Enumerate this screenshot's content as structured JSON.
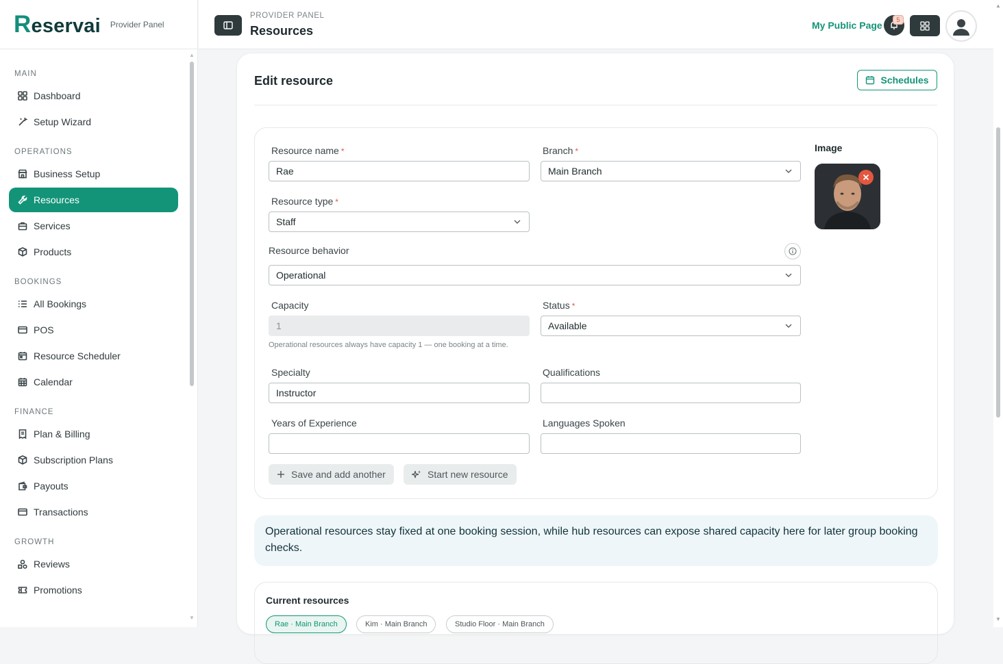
{
  "brand": {
    "logo_initial": "R",
    "logo_rest": "eservai",
    "subtitle": "Provider Panel"
  },
  "sidebar": {
    "sections": [
      {
        "title": "MAIN",
        "items": [
          {
            "label": "Dashboard",
            "icon": "grid-icon"
          },
          {
            "label": "Setup Wizard",
            "icon": "wand-icon"
          }
        ]
      },
      {
        "title": "OPERATIONS",
        "items": [
          {
            "label": "Business Setup",
            "icon": "store-icon"
          },
          {
            "label": "Resources",
            "icon": "wrench-icon",
            "active": true
          },
          {
            "label": "Services",
            "icon": "briefcase-icon"
          },
          {
            "label": "Products",
            "icon": "box-icon"
          }
        ]
      },
      {
        "title": "BOOKINGS",
        "items": [
          {
            "label": "All Bookings",
            "icon": "list-icon"
          },
          {
            "label": "POS",
            "icon": "card-icon"
          },
          {
            "label": "Resource Scheduler",
            "icon": "calendar-icon"
          },
          {
            "label": "Calendar",
            "icon": "calendar-grid-icon"
          }
        ]
      },
      {
        "title": "FINANCE",
        "items": [
          {
            "label": "Plan & Billing",
            "icon": "receipt-icon"
          },
          {
            "label": "Subscription Plans",
            "icon": "box-icon"
          },
          {
            "label": "Payouts",
            "icon": "wallet-icon"
          },
          {
            "label": "Transactions",
            "icon": "card-icon"
          }
        ]
      },
      {
        "title": "GROWTH",
        "items": [
          {
            "label": "Reviews",
            "icon": "shapes-icon"
          },
          {
            "label": "Promotions",
            "icon": "ticket-icon"
          }
        ]
      }
    ]
  },
  "header": {
    "breadcrumb": "PROVIDER PANEL",
    "title": "Resources",
    "public_link": "My Public Page",
    "notification_count": "5"
  },
  "main": {
    "card_title": "Edit resource",
    "schedules_label": "Schedules",
    "form": {
      "resource_name_label": "Resource name",
      "resource_name_value": "Rae",
      "branch_label": "Branch",
      "branch_value": "Main Branch",
      "resource_type_label": "Resource type",
      "resource_type_value": "Staff",
      "behavior_label": "Resource behavior",
      "behavior_value": "Operational",
      "capacity_label": "Capacity",
      "capacity_value": "1",
      "capacity_help": "Operational resources always have capacity 1 — one booking at a time.",
      "status_label": "Status",
      "status_value": "Available",
      "specialty_label": "Specialty",
      "specialty_value": "Instructor",
      "qualifications_label": "Qualifications",
      "qualifications_value": "",
      "experience_label": "Years of Experience",
      "experience_value": "",
      "languages_label": "Languages Spoken",
      "languages_value": "",
      "image_label": "Image",
      "required_mark": "*",
      "save_add_label": "Save and add another",
      "start_new_label": "Start new resource"
    },
    "note": "Operational resources stay fixed at one booking session, while hub resources can expose shared capacity here for later group booking checks.",
    "current": {
      "title": "Current resources",
      "chips": [
        "Rae · Main Branch",
        "Kim · Main Branch",
        "Studio Floor · Main Branch"
      ]
    }
  },
  "colors": {
    "accent": "#139478",
    "dark": "#2f3a3d",
    "danger": "#e4573f"
  }
}
